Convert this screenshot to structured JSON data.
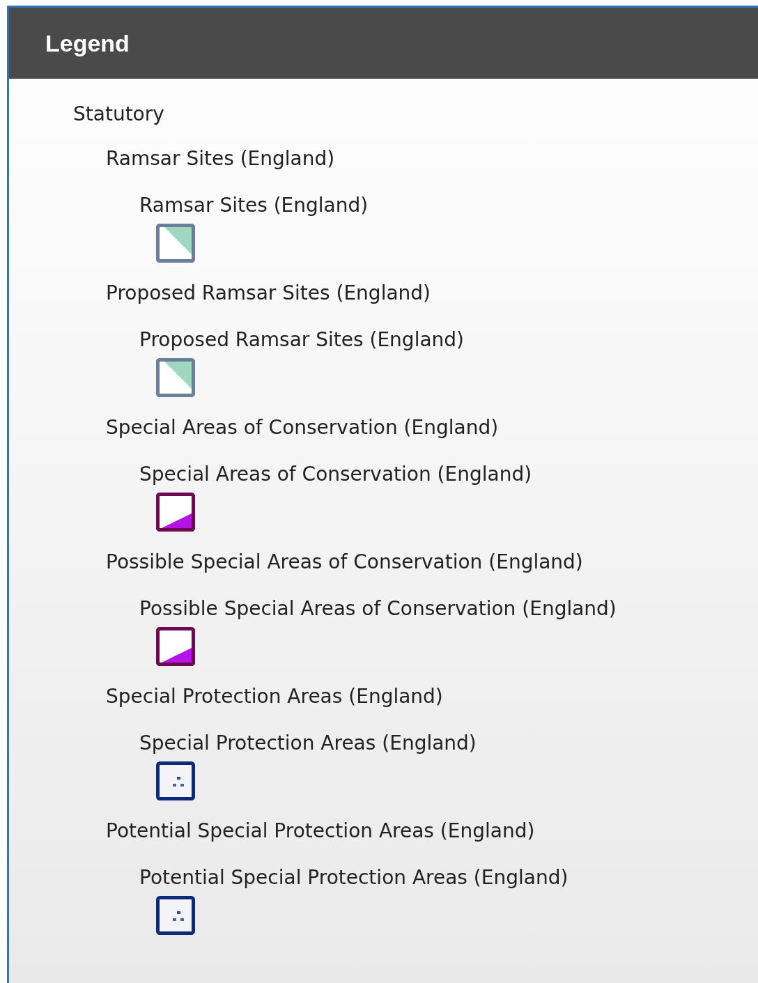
{
  "panel": {
    "title": "Legend"
  },
  "sections": [
    {
      "label": "Statutory",
      "children": [
        {
          "label": "Ramsar Sites (England)",
          "children": [
            {
              "label": "Ramsar Sites (England)",
              "swatch": {
                "kind": "corner-teal"
              }
            }
          ]
        },
        {
          "label": "Proposed Ramsar Sites (England)",
          "children": [
            {
              "label": "Proposed Ramsar Sites (England)",
              "swatch": {
                "kind": "corner-teal"
              }
            }
          ]
        },
        {
          "label": "Special Areas of Conservation (England)",
          "children": [
            {
              "label": "Special Areas of Conservation (England)",
              "swatch": {
                "kind": "corner-purple"
              }
            }
          ]
        },
        {
          "label": "Possible Special Areas of Conservation (England)",
          "children": [
            {
              "label": "Possible Special Areas of Conservation (England)",
              "swatch": {
                "kind": "corner-purple"
              }
            }
          ]
        },
        {
          "label": "Special Protection Areas (England)",
          "children": [
            {
              "label": "Special Protection Areas (England)",
              "swatch": {
                "kind": "dots"
              }
            }
          ]
        },
        {
          "label": "Potential Special Protection Areas (England)",
          "children": [
            {
              "label": "Potential Special Protection Areas (England)",
              "swatch": {
                "kind": "dots"
              }
            }
          ]
        }
      ]
    }
  ]
}
